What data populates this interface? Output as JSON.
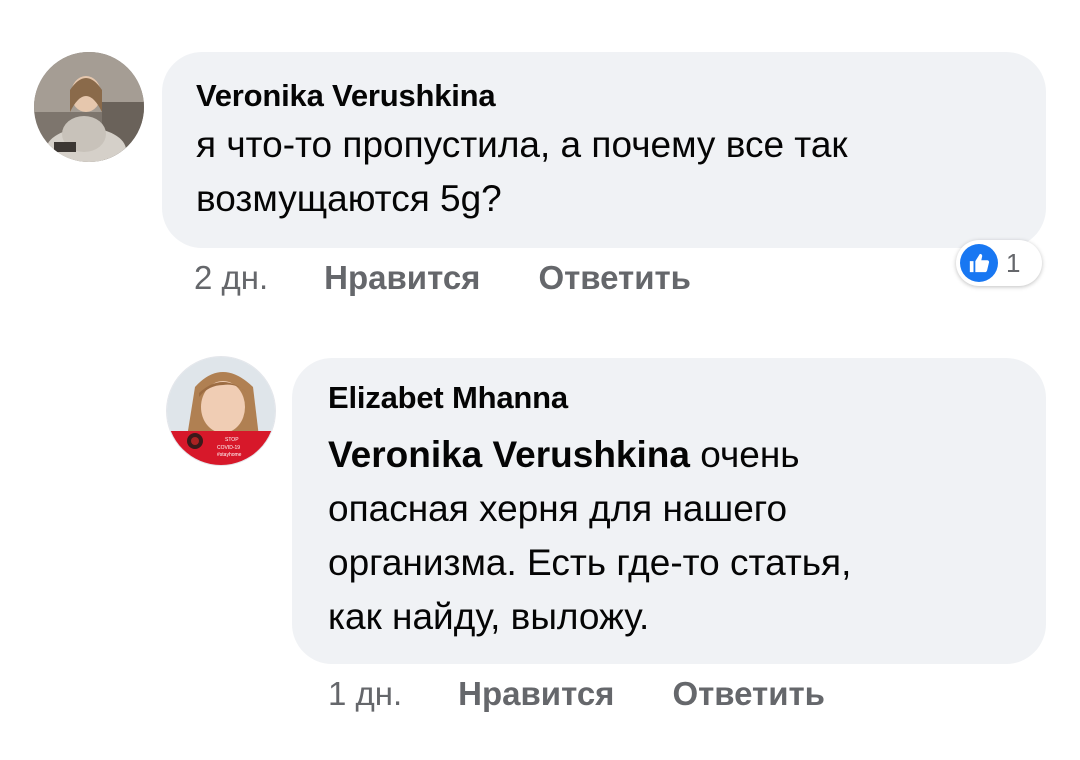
{
  "comments": [
    {
      "author": "Veronika Verushkina",
      "text_line1": "я что-то пропустила, а почему все так",
      "text_line2": "возмущаются 5g?",
      "time": "2 дн.",
      "like_label": "Нравится",
      "reply_label": "Ответить",
      "reaction_count": "1",
      "reaction_icon": "like-icon"
    },
    {
      "author": "Elizabet Mhanna",
      "mention": "Veronika Verushkina",
      "text_line1_rest": " очень",
      "text_line2": "опасная херня для нашего",
      "text_line3": "организма. Есть где-то статья,",
      "text_line4": "как найду, выложу.",
      "time": "1 дн.",
      "like_label": "Нравится",
      "reply_label": "Ответить",
      "avatar_badge": {
        "line1": "STOP",
        "line2": "COVID-19",
        "line3": "#stayhome"
      }
    }
  ],
  "colors": {
    "bubble": "#f0f2f5",
    "meta_text": "#65676b",
    "like_blue": "#1877f2",
    "badge_red": "#d7182a"
  }
}
